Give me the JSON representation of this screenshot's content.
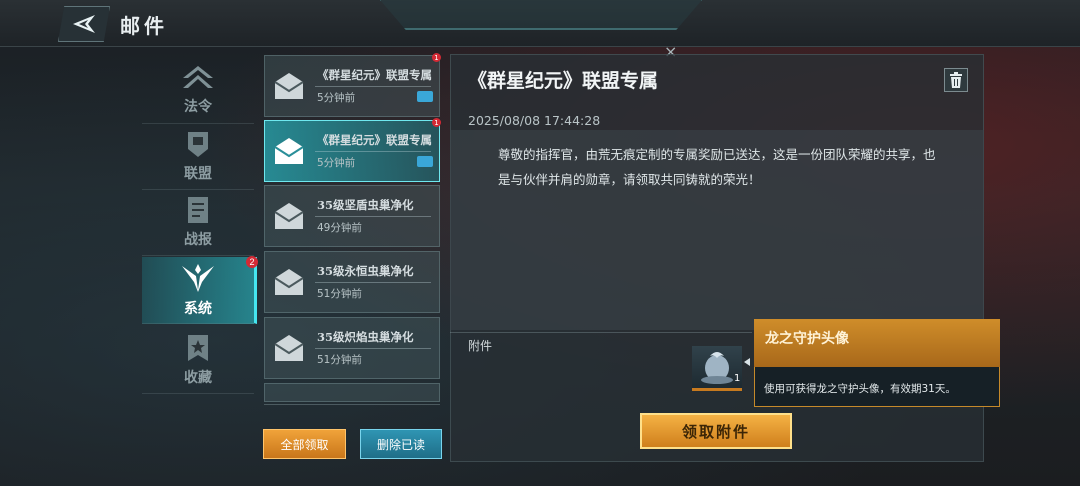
{
  "header": {
    "title": "邮件",
    "back_icon": "back-arrow-icon",
    "close_glyph": "×"
  },
  "categories": [
    {
      "label": "法令",
      "icon": "chevrons-up-icon",
      "active": false
    },
    {
      "label": "联盟",
      "icon": "shield-banner-icon",
      "active": false
    },
    {
      "label": "战报",
      "icon": "report-icon",
      "active": false
    },
    {
      "label": "系统",
      "icon": "wings-emblem-icon",
      "active": true,
      "badge": "2"
    },
    {
      "label": "收藏",
      "icon": "star-bookmark-icon",
      "active": false
    }
  ],
  "mails": [
    {
      "subject": "《群星纪元》联盟专属",
      "time": "5分钟前",
      "has_attachment": true,
      "unread_badge": "1",
      "active": false
    },
    {
      "subject": "《群星纪元》联盟专属",
      "time": "5分钟前",
      "has_attachment": true,
      "unread_badge": "1",
      "active": true
    },
    {
      "subject": "35级坚盾虫巢净化",
      "time": "49分钟前",
      "has_attachment": false,
      "active": false
    },
    {
      "subject": "35级永恒虫巢净化",
      "time": "51分钟前",
      "has_attachment": false,
      "active": false
    },
    {
      "subject": "35级炽焰虫巢净化",
      "time": "51分钟前",
      "has_attachment": false,
      "active": false
    }
  ],
  "list_buttons": {
    "collect_all": "全部领取",
    "delete_read": "删除已读"
  },
  "detail": {
    "title": "《群星纪元》联盟专属",
    "date": "2025/08/08  17:44:28",
    "body": "尊敬的指挥官，由荒无痕定制的专属奖励已送达，这是一份团队荣耀的共享，也是与伙伴并肩的勋章，请领取共同铸就的荣光！",
    "attachment_label": "附件",
    "attachment_item": {
      "count": "1",
      "icon": "dragon-statue-icon"
    },
    "tooltip": {
      "name": "龙之守护头像",
      "desc": "使用可获得龙之守护头像，有效期31天。"
    },
    "claim_button": "领取附件",
    "trash_icon": "trash-icon"
  },
  "colors": {
    "accent_cyan": "#45e6f0",
    "accent_orange": "#cf8d2a",
    "badge_red": "#d42a35"
  }
}
